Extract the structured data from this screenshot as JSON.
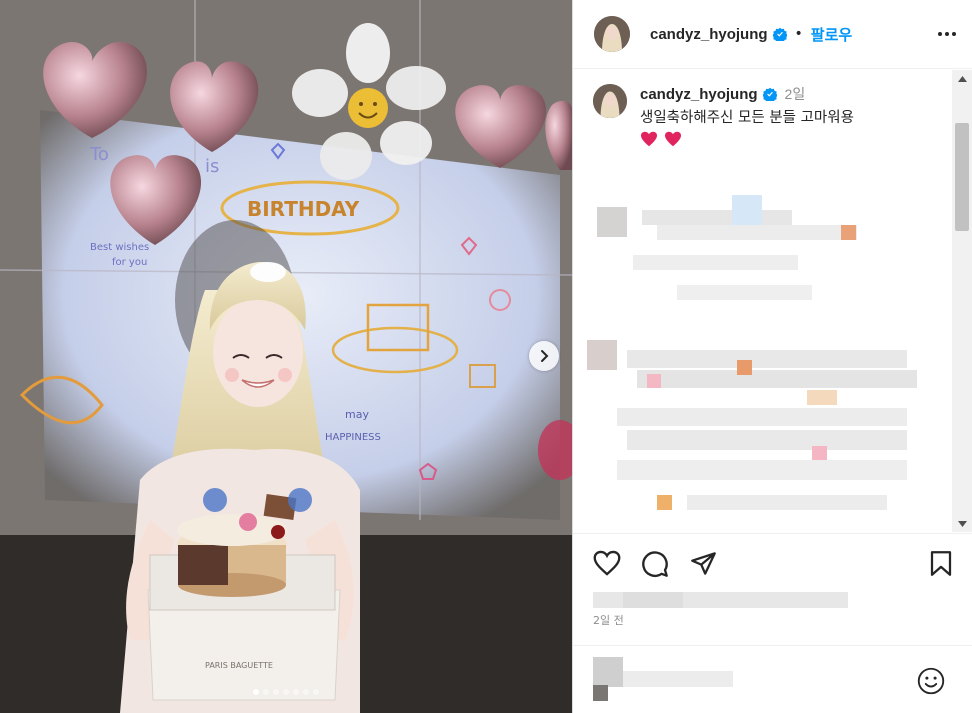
{
  "post": {
    "photo_alt": "Birthday photo",
    "slide_count": 7,
    "active_slide": 1
  },
  "header": {
    "username": "candyz_hyojung",
    "separator": "•",
    "follow_label": "팔로우"
  },
  "caption": {
    "username": "candyz_hyojung",
    "time": "2일",
    "text": "생일축하해주신 모든 분들 고마워용"
  },
  "footer": {
    "time_ago": "2일 전"
  },
  "colors": {
    "link_blue": "#0095f6",
    "verified_blue": "#0095f6",
    "heart_red": "#e0245e",
    "text": "#262626",
    "muted": "#8e8e8e"
  },
  "icons": [
    "chevron-right-icon",
    "verified-badge-icon",
    "more-icon",
    "heart-icon",
    "comment-icon",
    "share-icon",
    "bookmark-icon",
    "emoji-icon"
  ]
}
